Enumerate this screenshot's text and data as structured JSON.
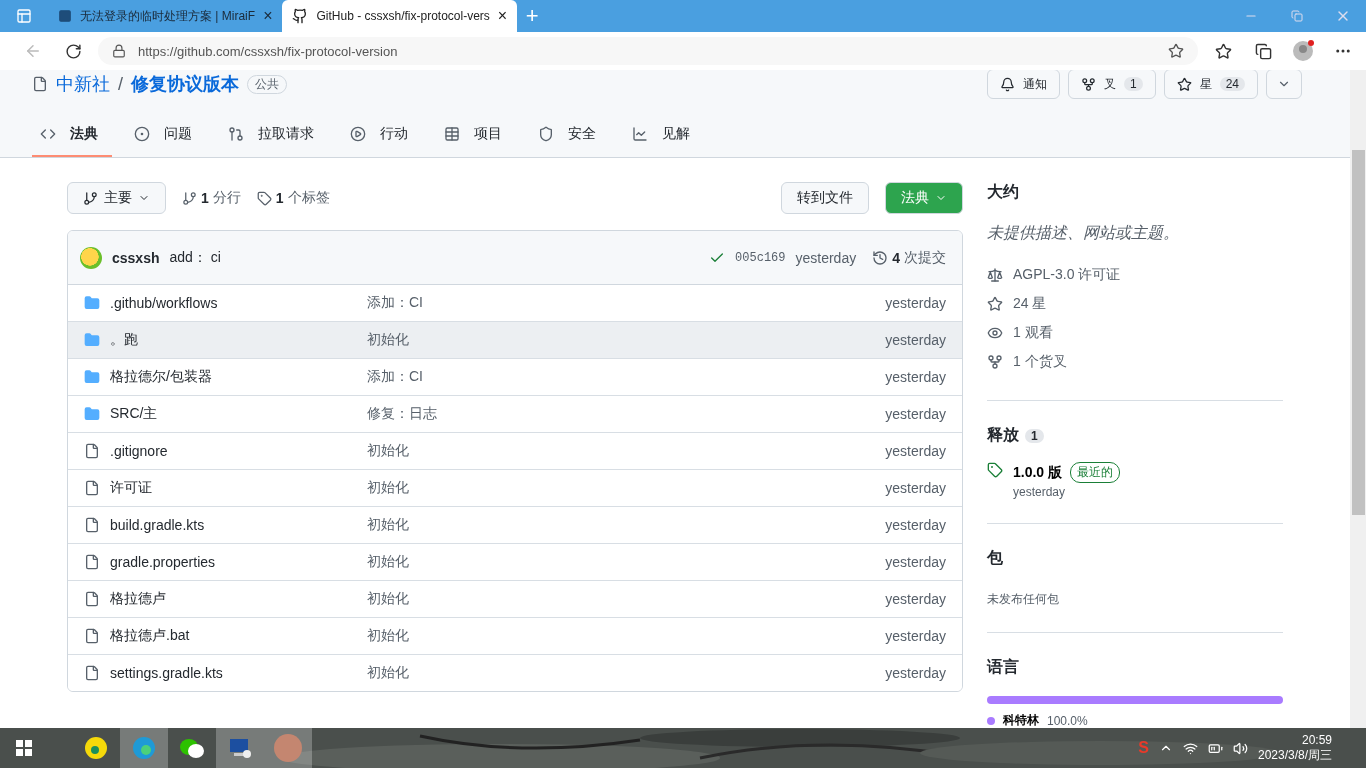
{
  "browser": {
    "tabs": [
      {
        "title": "无法登录的临时处理方案 | MiraiF",
        "selected": false,
        "close": "×"
      },
      {
        "title": "GitHub - cssxsh/fix-protocol-vers",
        "selected": true,
        "close": "×"
      }
    ],
    "new_tab": "+",
    "url": "https://github.com/cssxsh/fix-protocol-version"
  },
  "repo": {
    "owner": "中新社",
    "separator": "/",
    "name": "修复协议版本",
    "visibility": "公共",
    "actions": [
      {
        "label": "通知",
        "kind": "bell"
      },
      {
        "label": "叉",
        "count": "1",
        "kind": "fork"
      },
      {
        "label": "星",
        "count": "24",
        "kind": "star"
      }
    ]
  },
  "nav_tabs": [
    {
      "label": "法典",
      "kind": "code",
      "selected": true
    },
    {
      "label": "问题",
      "kind": "issue",
      "selected": false
    },
    {
      "label": "拉取请求",
      "kind": "pr",
      "selected": false
    },
    {
      "label": "行动",
      "kind": "play",
      "selected": false
    },
    {
      "label": "项目",
      "kind": "table",
      "selected": false
    },
    {
      "label": "安全",
      "kind": "shield",
      "selected": false
    },
    {
      "label": "见解",
      "kind": "graph",
      "selected": false
    }
  ],
  "toolbar": {
    "branch": "主要",
    "branches_count": "1",
    "branches_label": "分行",
    "tags_count": "1",
    "tags_label": "个标签",
    "goto_file": "转到文件",
    "code_button": "法典"
  },
  "commit": {
    "author": "cssxsh",
    "message": "add： ci",
    "hash": "005c169",
    "time": "yesterday",
    "count": "4",
    "count_label": "次提交"
  },
  "files": [
    {
      "kind": "folder",
      "name": ".github/workflows",
      "message": "添加：CI",
      "time": "yesterday",
      "hovered": false
    },
    {
      "kind": "folder",
      "name": "。跑",
      "message": "初始化",
      "time": "yesterday",
      "hovered": true
    },
    {
      "kind": "folder",
      "name": "格拉德尔/包装器",
      "message": "添加：CI",
      "time": "yesterday",
      "hovered": false
    },
    {
      "kind": "folder",
      "name": "SRC/主",
      "message": "修复：日志",
      "time": "yesterday",
      "hovered": false
    },
    {
      "kind": "file",
      "name": ".gitignore",
      "message": "初始化",
      "time": "yesterday",
      "hovered": false
    },
    {
      "kind": "file",
      "name": "许可证",
      "message": "初始化",
      "time": "yesterday",
      "hovered": false
    },
    {
      "kind": "file",
      "name": "build.gradle.kts",
      "message": "初始化",
      "time": "yesterday",
      "hovered": false
    },
    {
      "kind": "file",
      "name": "gradle.properties",
      "message": "初始化",
      "time": "yesterday",
      "hovered": false
    },
    {
      "kind": "file",
      "name": "格拉德卢",
      "message": "初始化",
      "time": "yesterday",
      "hovered": false
    },
    {
      "kind": "file",
      "name": "格拉德卢.bat",
      "message": "初始化",
      "time": "yesterday",
      "hovered": false
    },
    {
      "kind": "file",
      "name": "settings.gradle.kts",
      "message": "初始化",
      "time": "yesterday",
      "hovered": false
    }
  ],
  "about": {
    "title": "大约",
    "description": "未提供描述、网站或主题。",
    "facts": [
      {
        "kind": "law",
        "text": "AGPL-3.0 许可证"
      },
      {
        "kind": "star",
        "text": "24 星"
      },
      {
        "kind": "eye",
        "text": "1 观看"
      },
      {
        "kind": "fork",
        "text": "1 个货叉"
      }
    ]
  },
  "releases": {
    "title": "释放",
    "count": "1",
    "tag": "1.0.0 版",
    "badge": "最近的",
    "time": "yesterday"
  },
  "packages": {
    "title": "包",
    "text": "未发布任何包"
  },
  "languages": {
    "title": "语言",
    "items": [
      {
        "name": "科特林",
        "percent": "100.0%",
        "color": "#a97bff",
        "level": 1
      }
    ]
  },
  "taskbar": {
    "input_method": "S",
    "time": "20:59",
    "date": "2023/3/8/周三"
  }
}
